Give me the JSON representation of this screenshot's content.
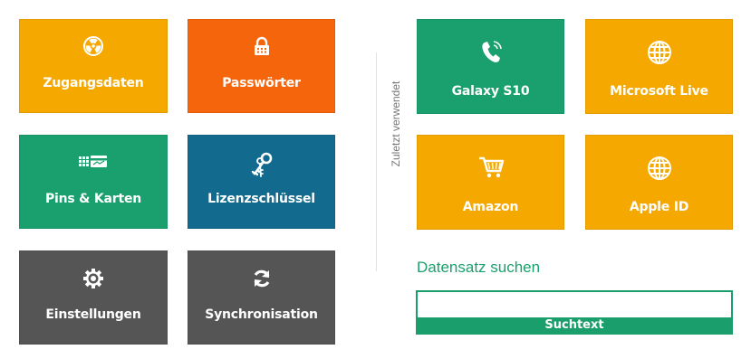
{
  "colors": {
    "orange": "#f5a800",
    "dark_orange": "#f5650c",
    "green": "#1aa06e",
    "teal_blue": "#126b8e",
    "dark_gray": "#555555",
    "white": "#ffffff"
  },
  "categories": [
    {
      "label": "Zugangsdaten",
      "icon": "radiation-icon",
      "color": "#f5a800"
    },
    {
      "label": "Passwörter",
      "icon": "lock-icon",
      "color": "#f5650c"
    },
    {
      "label": "Pins & Karten",
      "icon": "cards-icon",
      "color": "#1aa06e"
    },
    {
      "label": "Lizenzschlüssel",
      "icon": "keys-icon",
      "color": "#126b8e"
    },
    {
      "label": "Einstellungen",
      "icon": "gear-icon",
      "color": "#555555"
    },
    {
      "label": "Synchronisation",
      "icon": "sync-icon",
      "color": "#555555"
    }
  ],
  "recent": {
    "heading": "Zuletzt verwendet",
    "items": [
      {
        "label": "Galaxy S10",
        "icon": "phone-icon",
        "color": "#1aa06e"
      },
      {
        "label": "Microsoft Live",
        "icon": "globe-icon",
        "color": "#f5a800"
      },
      {
        "label": "Amazon",
        "icon": "cart-icon",
        "color": "#f5a800"
      },
      {
        "label": "Apple ID",
        "icon": "globe-icon",
        "color": "#f5a800"
      }
    ]
  },
  "search": {
    "title": "Datensatz suchen",
    "input_value": "",
    "button_label": "Suchtext"
  }
}
